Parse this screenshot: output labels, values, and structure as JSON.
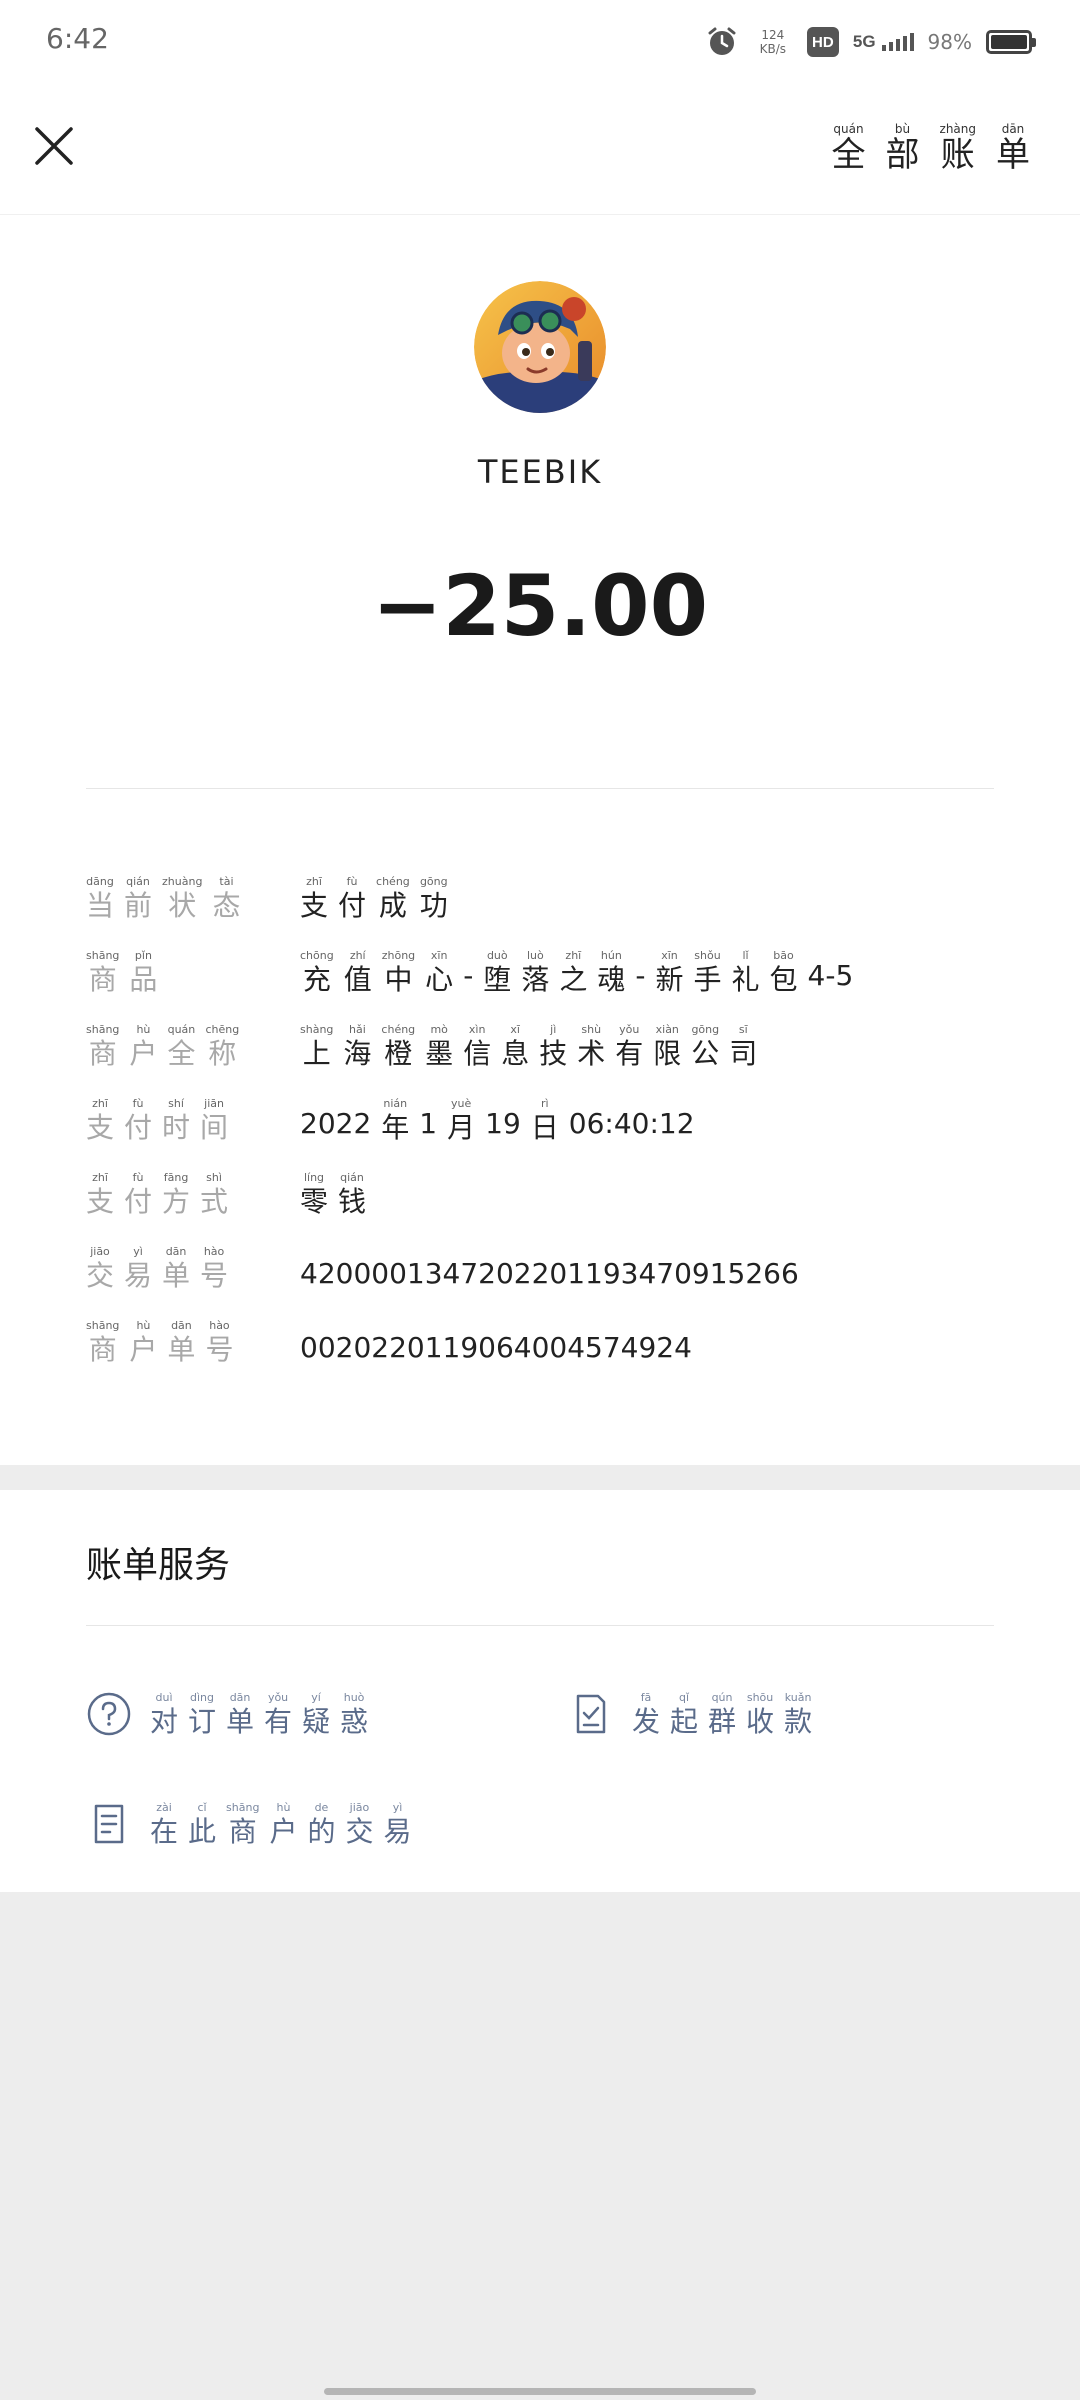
{
  "status_bar": {
    "time": "6:42",
    "net_speed_value": "124",
    "net_speed_unit": "KB/s",
    "hd_badge": "HD",
    "network": "5G",
    "battery_percent": "98%"
  },
  "nav": {
    "close_icon": "close-icon",
    "all_bills": [
      {
        "py": "quán",
        "hz": "全"
      },
      {
        "py": "bù",
        "hz": "部"
      },
      {
        "py": "zhàng",
        "hz": "账"
      },
      {
        "py": "dān",
        "hz": "单"
      }
    ]
  },
  "merchant": {
    "name": "TEEBIK",
    "amount": "−25.00"
  },
  "details": {
    "status": {
      "label": [
        {
          "py": "dāng",
          "hz": "当"
        },
        {
          "py": "qián",
          "hz": "前"
        },
        {
          "py": "zhuàng",
          "hz": "状"
        },
        {
          "py": "tài",
          "hz": "态"
        }
      ],
      "value": [
        {
          "py": "zhī",
          "hz": "支"
        },
        {
          "py": "fù",
          "hz": "付"
        },
        {
          "py": "chéng",
          "hz": "成"
        },
        {
          "py": "gōng",
          "hz": "功"
        }
      ]
    },
    "product": {
      "label": [
        {
          "py": "shāng",
          "hz": "商"
        },
        {
          "py": "pǐn",
          "hz": "品"
        }
      ],
      "value": [
        {
          "py": "chōng",
          "hz": "充"
        },
        {
          "py": "zhí",
          "hz": "值"
        },
        {
          "py": "zhōng",
          "hz": "中"
        },
        {
          "py": "xīn",
          "hz": "心"
        },
        {
          "py": "",
          "hz": "-"
        },
        {
          "py": "duò",
          "hz": "堕"
        },
        {
          "py": "luò",
          "hz": "落"
        },
        {
          "py": "zhī",
          "hz": "之"
        },
        {
          "py": "hún",
          "hz": "魂"
        },
        {
          "py": "",
          "hz": "-"
        },
        {
          "py": "xīn",
          "hz": "新"
        },
        {
          "py": "shǒu",
          "hz": "手"
        },
        {
          "py": "lǐ",
          "hz": "礼"
        },
        {
          "py": "bāo",
          "hz": "包"
        },
        {
          "py": "",
          "hz": "4-5"
        }
      ]
    },
    "merchant_full_name": {
      "label": [
        {
          "py": "shāng",
          "hz": "商"
        },
        {
          "py": "hù",
          "hz": "户"
        },
        {
          "py": "quán",
          "hz": "全"
        },
        {
          "py": "chēng",
          "hz": "称"
        }
      ],
      "value": [
        {
          "py": "shàng",
          "hz": "上"
        },
        {
          "py": "hǎi",
          "hz": "海"
        },
        {
          "py": "chéng",
          "hz": "橙"
        },
        {
          "py": "mò",
          "hz": "墨"
        },
        {
          "py": "xìn",
          "hz": "信"
        },
        {
          "py": "xī",
          "hz": "息"
        },
        {
          "py": "jì",
          "hz": "技"
        },
        {
          "py": "shù",
          "hz": "术"
        },
        {
          "py": "yǒu",
          "hz": "有"
        },
        {
          "py": "xiàn",
          "hz": "限"
        },
        {
          "py": "gōng",
          "hz": "公"
        },
        {
          "py": "sī",
          "hz": "司"
        }
      ]
    },
    "pay_time": {
      "label": [
        {
          "py": "zhī",
          "hz": "支"
        },
        {
          "py": "fù",
          "hz": "付"
        },
        {
          "py": "shí",
          "hz": "时"
        },
        {
          "py": "jiān",
          "hz": "间"
        }
      ],
      "value": [
        {
          "py": "",
          "hz": "2022"
        },
        {
          "py": "nián",
          "hz": "年"
        },
        {
          "py": "",
          "hz": "1"
        },
        {
          "py": "yuè",
          "hz": "月"
        },
        {
          "py": "",
          "hz": "19"
        },
        {
          "py": "rì",
          "hz": "日"
        },
        {
          "py": "",
          "hz": "06:40:12"
        }
      ]
    },
    "pay_method": {
      "label": [
        {
          "py": "zhī",
          "hz": "支"
        },
        {
          "py": "fù",
          "hz": "付"
        },
        {
          "py": "fāng",
          "hz": "方"
        },
        {
          "py": "shì",
          "hz": "式"
        }
      ],
      "value": [
        {
          "py": "líng",
          "hz": "零"
        },
        {
          "py": "qián",
          "hz": "钱"
        }
      ]
    },
    "transaction_no": {
      "label": [
        {
          "py": "jiāo",
          "hz": "交"
        },
        {
          "py": "yì",
          "hz": "易"
        },
        {
          "py": "dān",
          "hz": "单"
        },
        {
          "py": "hào",
          "hz": "号"
        }
      ],
      "value": "4200001347202201193470915266"
    },
    "merchant_order_no": {
      "label": [
        {
          "py": "shāng",
          "hz": "商"
        },
        {
          "py": "hù",
          "hz": "户"
        },
        {
          "py": "dān",
          "hz": "单"
        },
        {
          "py": "hào",
          "hz": "号"
        }
      ],
      "value": "0020220119064004574924"
    }
  },
  "services": {
    "title": "账单服务",
    "question_icon": "question-circle-icon",
    "group_collect_icon": "document-check-icon",
    "merchant_tx_icon": "document-list-icon",
    "order_question": [
      {
        "py": "duì",
        "hz": "对"
      },
      {
        "py": "dìng",
        "hz": "订"
      },
      {
        "py": "dān",
        "hz": "单"
      },
      {
        "py": "yǒu",
        "hz": "有"
      },
      {
        "py": "yí",
        "hz": "疑"
      },
      {
        "py": "huò",
        "hz": "惑"
      }
    ],
    "group_collect": [
      {
        "py": "fā",
        "hz": "发"
      },
      {
        "py": "qǐ",
        "hz": "起"
      },
      {
        "py": "qún",
        "hz": "群"
      },
      {
        "py": "shōu",
        "hz": "收"
      },
      {
        "py": "kuǎn",
        "hz": "款"
      }
    ],
    "merchant_transactions": [
      {
        "py": "zài",
        "hz": "在"
      },
      {
        "py": "cǐ",
        "hz": "此"
      },
      {
        "py": "shāng",
        "hz": "商"
      },
      {
        "py": "hù",
        "hz": "户"
      },
      {
        "py": "de",
        "hz": "的"
      },
      {
        "py": "jiāo",
        "hz": "交"
      },
      {
        "py": "yì",
        "hz": "易"
      }
    ]
  }
}
